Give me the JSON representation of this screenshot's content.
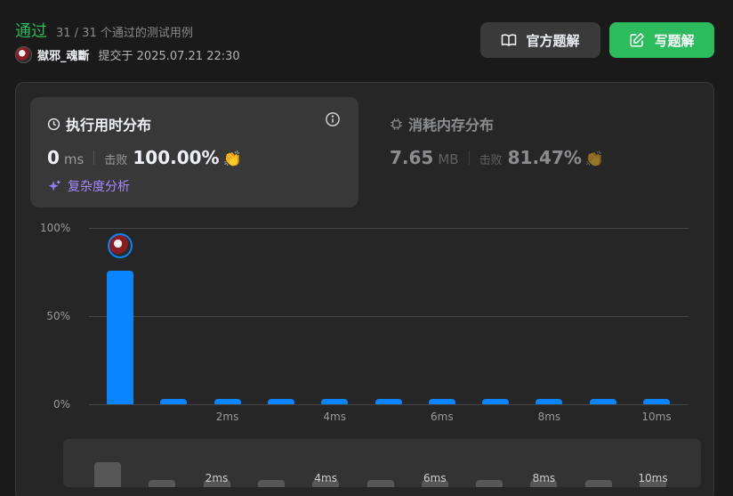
{
  "header": {
    "status": "通过",
    "testcases": "31 / 31 个通过的测试用例",
    "username": "獄邪_魂斷",
    "submitted_at": "提交于 2025.07.21 22:30",
    "solution_button": "官方题解",
    "write_button": "写题解"
  },
  "runtime": {
    "title": "执行用时分布",
    "value": "0",
    "unit": "ms",
    "beats_label": "击败",
    "beats_value": "100.00%",
    "analysis_link": "复杂度分析"
  },
  "memory": {
    "title": "消耗内存分布",
    "value": "7.65",
    "unit": "MB",
    "beats_label": "击败",
    "beats_value": "81.47%"
  },
  "chart_data": {
    "type": "bar",
    "y_ticks": [
      "100%",
      "50%",
      "0%"
    ],
    "ylim": [
      0,
      100
    ],
    "x_ticks": [
      "2ms",
      "4ms",
      "6ms",
      "8ms",
      "10ms"
    ],
    "categories": [
      "0ms",
      "1ms",
      "2ms",
      "3ms",
      "4ms",
      "5ms",
      "6ms",
      "7ms",
      "8ms",
      "9ms",
      "10ms"
    ],
    "values": [
      76,
      3,
      3,
      3,
      3,
      3,
      3,
      3,
      3,
      3,
      3
    ],
    "highlight_index": 0,
    "bar_color": "#0a84ff"
  },
  "minimap": {
    "x_ticks": [
      "2ms",
      "4ms",
      "6ms",
      "8ms",
      "10ms"
    ],
    "values": [
      76,
      3,
      3,
      3,
      3,
      3,
      3,
      3,
      3,
      3,
      3
    ]
  },
  "colors": {
    "accent_green": "#2cbb5d",
    "bar_blue": "#0a84ff",
    "purple_link": "#a58bff"
  }
}
